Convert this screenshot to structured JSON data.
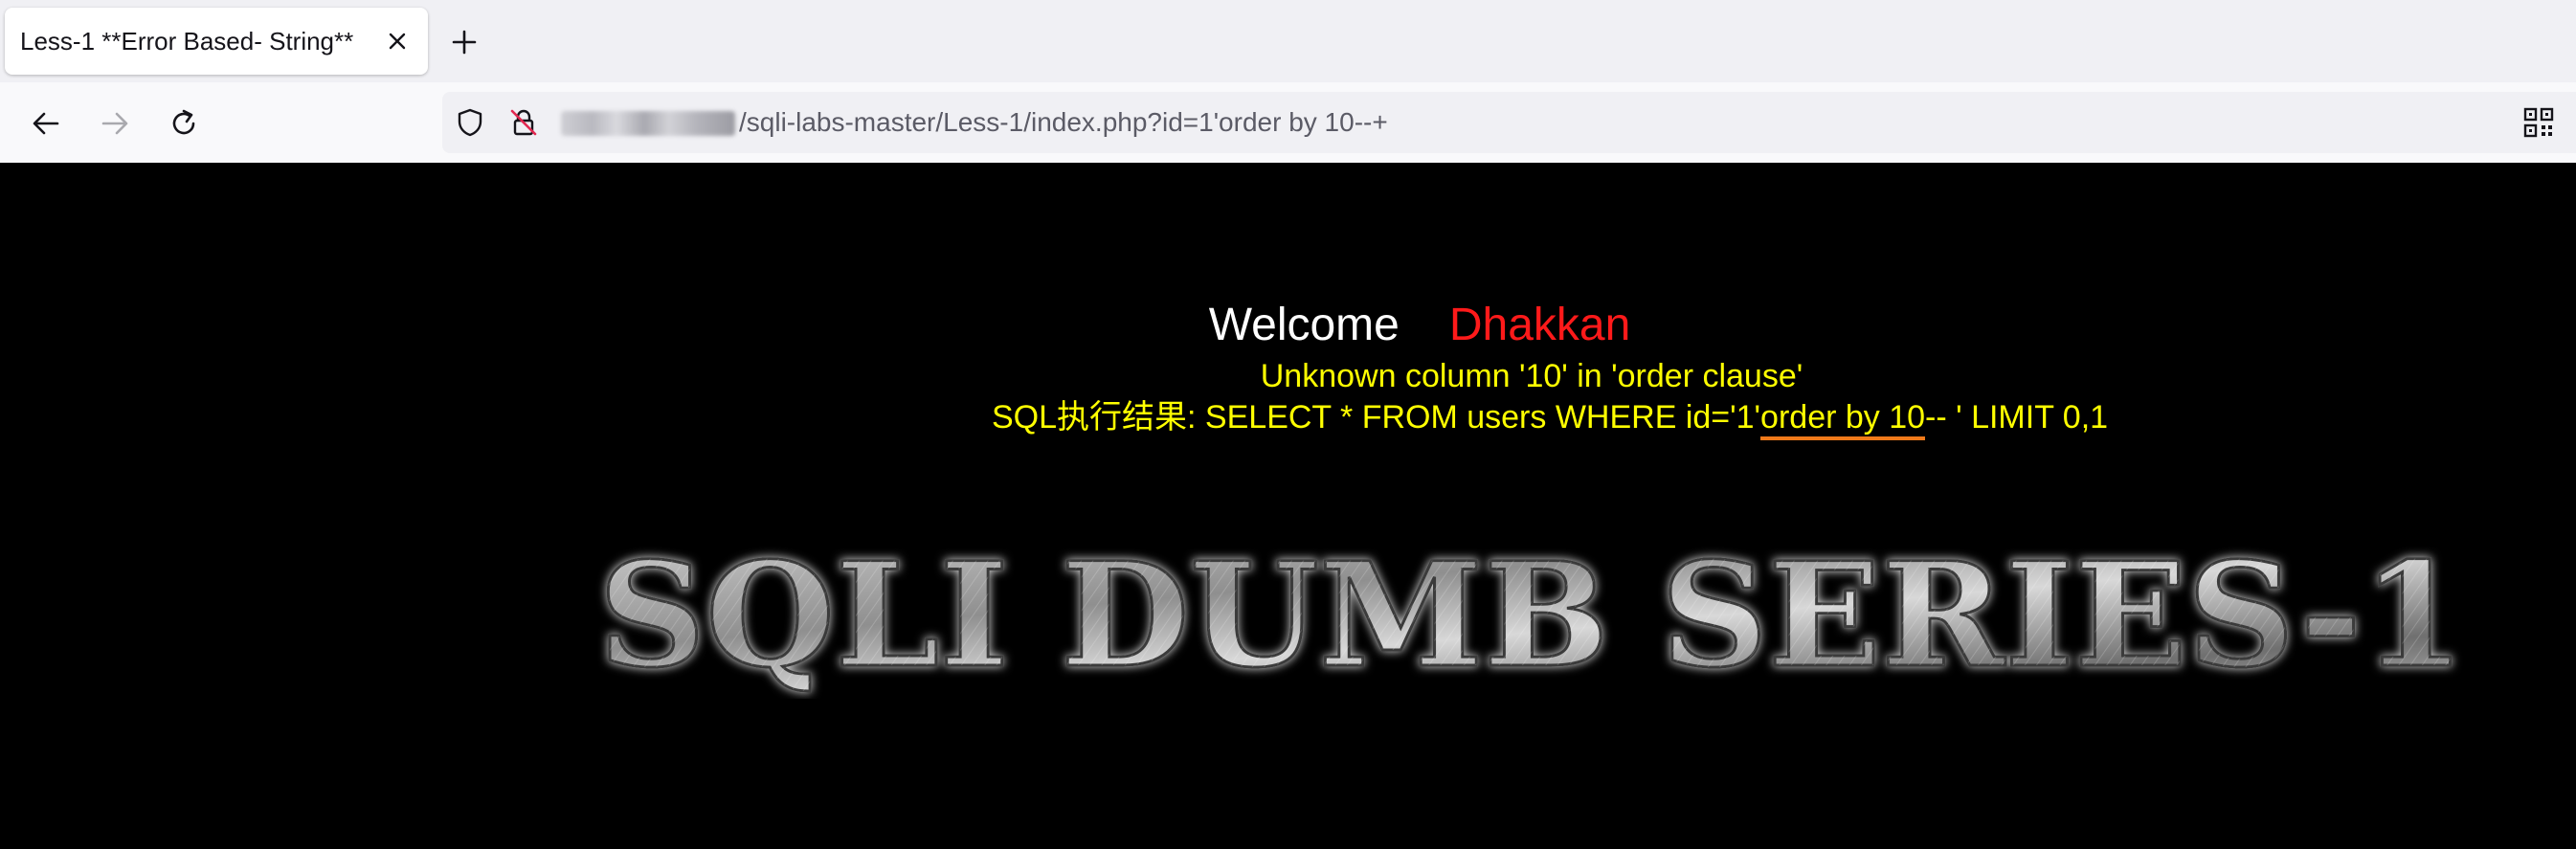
{
  "browser": {
    "tab": {
      "title": "Less-1 **Error Based- String**",
      "close_icon": "close-icon"
    },
    "new_tab_icon": "plus-icon",
    "nav": {
      "back_icon": "back-arrow-icon",
      "forward_icon": "forward-arrow-icon",
      "reload_icon": "reload-icon"
    },
    "url_bar": {
      "shield_icon": "shield-icon",
      "insecure_lock_icon": "insecure-lock-icon",
      "url_visible": "/sqli-labs-master/Less-1/index.php?id=1'order by 10--+",
      "qr_icon": "qr-code-icon"
    }
  },
  "page": {
    "welcome_word": "Welcome",
    "welcome_name": "Dhakkan",
    "error_message": "Unknown column '10' in 'order clause'",
    "sql_prefix": "SQL执行结果: SELECT * FROM users WHERE id='1'",
    "sql_highlight": "order by 10",
    "sql_suffix": "-- ' LIMIT 0,1",
    "banner_text": "SQLI DUMB SERIES-1"
  },
  "colors": {
    "background": "#000000",
    "welcome": "#ffffff",
    "name": "#ff1a1a",
    "message": "#ffff00",
    "highlight_underline": "#f07a1a"
  }
}
